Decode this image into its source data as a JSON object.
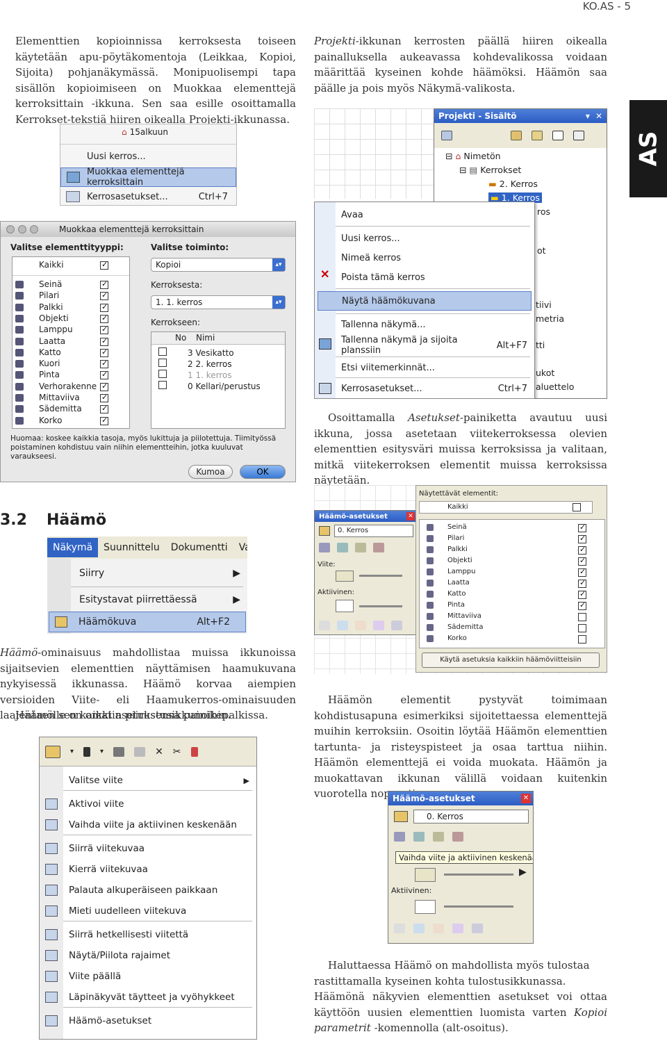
{
  "header": {
    "page_label": "KO.AS - 5"
  },
  "side_tab": {
    "label": "AS",
    "color": "#1a1a1a"
  },
  "left_col": {
    "p1": "Elementtien kopioinnissa kerroksesta toiseen käytetään apu-pöytäkomentoja (Leikkaa, Kopioi, Sijoita) pohjanäkymässä. Monipuolisempi tapa sisällön kopioimiseen on Muokkaa elementtejä kerroksittain -ikkuna. Sen saa esille osoittamalla Kerrokset-tekstiä hiiren oikealla Projekti-ikkunassa.",
    "section_num": "3.2",
    "section_title": "Häämö",
    "p2_italic": "Häämö",
    "p2": "-ominaisuus mahdollistaa muissa ikkunoissa sijaitsevien elementtien näyttämisen haamukuvana nykyisessä ikkunassa. Häämö korvaa aiempien versioiden Viite- eli Haamukerros-ominaisuuden laajentaen sen kaikkiin piirustusikkunoihin.",
    "p3": "Häämölle on omat asetuksensa painikepalkissa."
  },
  "right_col": {
    "p1_italic": "Projekti",
    "p1": "-ikkunan kerrosten päällä hiiren oikealla painalluksella aukeavassa kohdevalikossa voidaan määrittää kyseinen kohde häämöksi. Häämön saa päälle ja pois myös Näkymä-valikosta.",
    "p2_pre": "Osoittamalla ",
    "p2_italic": "Asetukset",
    "p2": "-painiketta avautuu uusi ikkuna, jossa asetetaan viitekerroksessa olevien elementtien esitysväri muissa kerroksissa ja valitaan, mitkä viitekerroksen elementit muissa kerroksissa näytetään.",
    "p3": "Häämön elementit pystyvät toimimaan kohdistusapuna esimerkiksi sijoitettaessa elementtejä muihin kerroksiin. Osoitin löytää Häämön elementtien tartunta- ja risteyspisteet ja osaa tarttua niihin. Häämön elementtejä ei voida muokata. Häämön ja muokattavan ikkunan välillä voidaan kuitenkin vuorotella nopeasti.",
    "p4": "Haluttaessa Häämö on mahdollista myös tulostaa rastittamalla kyseinen kohta tulostusikkunassa.",
    "p5_pre": "Häämönä näkyvien elementtien asetukset voi ottaa käyttöön uusien elementtien luomista varten ",
    "p5_italic": "Kopioi parametrit",
    "p5": " -komennolla (alt-osoitus)."
  },
  "shot_context_small": {
    "tree_item": "15alkuun",
    "items": [
      {
        "label": "Uusi kerros..."
      },
      {
        "label": "Muokkaa elementtejä kerroksittain",
        "selected": true
      },
      {
        "label": "Kerrosasetukset...",
        "shortcut": "Ctrl+7"
      }
    ]
  },
  "shot_mac_dialog": {
    "title": "Muokkaa elementtejä kerroksittain",
    "left_label": "Valitse elementtityyppi:",
    "all_label": "Kaikki",
    "types": [
      "Seinä",
      "Pilari",
      "Palkki",
      "Objekti",
      "Lamppu",
      "Laatta",
      "Katto",
      "Kuori",
      "Pinta",
      "Verhorakenne",
      "Mittaviiva",
      "Sädemitta",
      "Korko"
    ],
    "action_label": "Valitse toiminto:",
    "action_value": "Kopioi",
    "from_label": "Kerroksesta:",
    "from_value": "1. 1. kerros",
    "to_label": "Kerrokseen:",
    "table_headers": [
      "No",
      "Nimi"
    ],
    "table_rows": [
      {
        "name": "3 Vesikatto",
        "dim": false
      },
      {
        "name": "2 2. kerros",
        "dim": false
      },
      {
        "name": "1 1. kerros",
        "dim": true
      },
      {
        "name": "0 Kellari/perustus",
        "dim": false
      }
    ],
    "note": "Huomaa: koskee kaikkia tasoja, myös lukittuja ja piilotettuja. Tiimityössä poistaminen kohdistuu vain niihin elementteihin, jotka kuuluvat varaukseesi.",
    "cancel": "Kumoa",
    "ok": "OK"
  },
  "shot_projekti": {
    "title": "Projekti - Sisältö",
    "tree": [
      "Nimetön",
      "Kerrokset",
      "2. Kerros",
      "1. Kerros"
    ],
    "menu": [
      {
        "label": "Avaa",
        "shortcut": ""
      },
      {
        "label": "Uusi kerros...",
        "shortcut": ""
      },
      {
        "label": "Nimeä kerros",
        "shortcut": ""
      },
      {
        "label": "Poista tämä kerros",
        "shortcut": ""
      },
      {
        "label": "Näytä häämökuvana",
        "shortcut": "",
        "selected": true
      },
      {
        "label": "Tallenna näkymä...",
        "shortcut": ""
      },
      {
        "label": "Tallenna näkymä ja sijoita planssiin",
        "shortcut": "Alt+F7"
      },
      {
        "label": "Etsi viitemerkinnät...",
        "shortcut": ""
      },
      {
        "label": "Kerrosasetukset...",
        "shortcut": "Ctrl+7"
      }
    ],
    "behind_fragments": [
      "ros",
      "ot",
      "tiivi",
      "metria",
      "tti",
      "ukot",
      "aluettelo"
    ]
  },
  "shot_nakyma_menu": {
    "menubar": [
      "Näkymä",
      "Suunnittelu",
      "Dokumentti",
      "Vail"
    ],
    "items": [
      {
        "label": "Siirry",
        "shortcut": "",
        "arrow": true
      },
      {
        "label": "Esitystavat piirrettäessä",
        "shortcut": "",
        "arrow": true
      },
      {
        "label": "Häämökuva",
        "shortcut": "Alt+F2",
        "selected": true
      }
    ]
  },
  "shot_haamo_settings": {
    "title": "Häämö-asetukset",
    "layer": "0. Kerros",
    "viite_label": "Viite:",
    "aktiivinen_label": "Aktiivinen:",
    "visible_label": "Näytettävät elementit:",
    "all_label": "Kaikki",
    "elements": [
      {
        "name": "Seinä",
        "on": true
      },
      {
        "name": "Pilari",
        "on": true
      },
      {
        "name": "Palkki",
        "on": true
      },
      {
        "name": "Objekti",
        "on": true
      },
      {
        "name": "Lamppu",
        "on": true
      },
      {
        "name": "Laatta",
        "on": true
      },
      {
        "name": "Katto",
        "on": true
      },
      {
        "name": "Pinta",
        "on": true
      },
      {
        "name": "Mittaviiva",
        "on": false
      },
      {
        "name": "Sädemitta",
        "on": false
      },
      {
        "name": "Korko",
        "on": false
      }
    ],
    "apply_button": "Käytä asetuksia kaikkiin häämöviitteisiin"
  },
  "shot_toolbar_menu": {
    "items": [
      {
        "label": "Valitse viite",
        "arrow": true
      },
      {
        "label": "Aktivoi viite"
      },
      {
        "label": "Vaihda viite ja aktiivinen keskenään"
      },
      {
        "label": "Siirrä viitekuvaa"
      },
      {
        "label": "Kierrä viitekuvaa"
      },
      {
        "label": "Palauta alkuperäiseen paikkaan"
      },
      {
        "label": "Mieti uudelleen viitekuva"
      },
      {
        "label": "Siirrä hetkellisesti viitettä"
      },
      {
        "label": "Näytä/Piilota rajaimet"
      },
      {
        "label": "Viite päällä"
      },
      {
        "label": "Läpinäkyvät täytteet ja vyöhykkeet"
      },
      {
        "label": "Häämö-asetukset"
      }
    ]
  },
  "shot_haamo_small": {
    "title": "Häämö-asetukset",
    "layer": "0. Kerros",
    "tooltip": "Vaihda viite ja aktiivinen keskenään",
    "aktiivinen_label": "Aktiivinen:"
  },
  "colors": {
    "accent_blue": "#2b5cc4",
    "selection": "#b5c9ea",
    "xp_face": "#ece9d8"
  }
}
